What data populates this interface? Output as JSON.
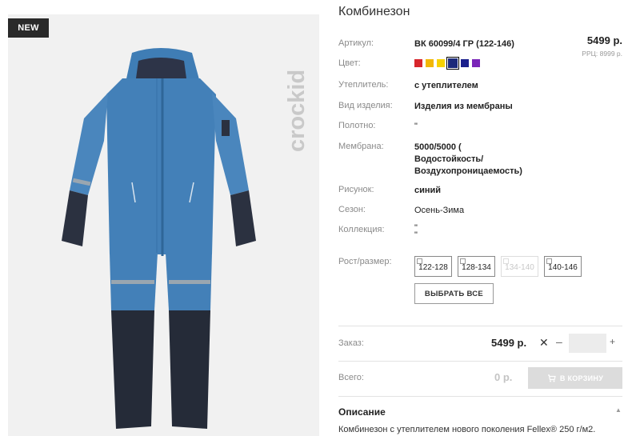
{
  "product": {
    "badge": "NEW",
    "brand": "crockid",
    "title": "Комбинезон",
    "price": "5499 р.",
    "rrp": "РРЦ: 8999 р."
  },
  "specs": [
    {
      "label": "Артикул:",
      "value": "ВК 60099/4 ГР (122-146)",
      "bold": true
    },
    {
      "label": "Цвет:",
      "value": ""
    },
    {
      "label": "Утеплитель:",
      "value": "с утеплителем",
      "bold": true
    },
    {
      "label": "Вид изделия:",
      "value": "Изделия из мембраны",
      "bold": true
    },
    {
      "label": "Полотно:",
      "value": "\"",
      "bold": false
    },
    {
      "label": "Мембрана:",
      "value_lines": [
        "5000/5000 (",
        "Водостойкость/",
        "Воздухопроницаемость)"
      ],
      "bold": true
    },
    {
      "label": "Рисунок:",
      "value": "синий",
      "bold": true
    },
    {
      "label": "Сезон:",
      "value": "Осень-Зима",
      "bold": false
    },
    {
      "label": "Коллекция:",
      "value_lines": [
        "\"",
        "\""
      ],
      "bold": false
    }
  ],
  "colors": [
    {
      "hex": "#d7262c",
      "selected": false
    },
    {
      "hex": "#f2b705",
      "selected": false
    },
    {
      "hex": "#f7d200",
      "selected": false
    },
    {
      "hex": "#1c2a7a",
      "selected": true
    },
    {
      "hex": "#1a1f8c",
      "selected": false
    },
    {
      "hex": "#7a25b8",
      "selected": false
    }
  ],
  "size": {
    "label": "Рост/размер:",
    "options": [
      {
        "label": "122-128",
        "available": true
      },
      {
        "label": "128-134",
        "available": true
      },
      {
        "label": "134-140",
        "available": false
      },
      {
        "label": "140-146",
        "available": true
      }
    ],
    "select_all": "ВЫБРАТЬ ВСЕ"
  },
  "order": {
    "label": "Заказ:",
    "price": "5499 р.",
    "clear_symbol": "✕",
    "minus": "–",
    "plus": "+",
    "quantity": ""
  },
  "total": {
    "label": "Всего:",
    "value": "0 р.",
    "cart_button": "В КОРЗИНУ"
  },
  "description": {
    "title": "Описание",
    "toggle": "▲",
    "text": "Комбинезон с утеплителем нового поколения Fellex® 250 г/м2."
  }
}
